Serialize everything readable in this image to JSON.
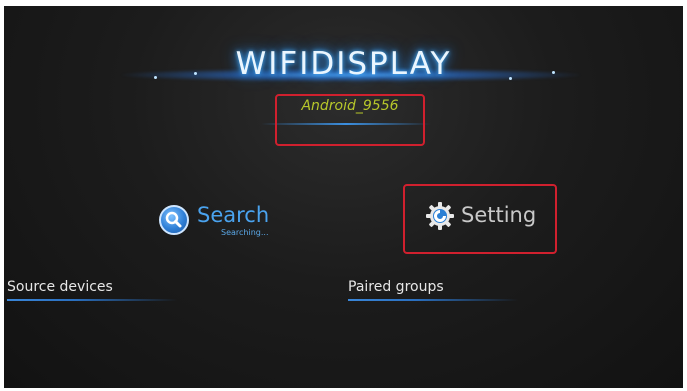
{
  "app": {
    "logo_text": "WIFIDISPLAY",
    "device_name": "Android_9556"
  },
  "buttons": {
    "search_label": "Search",
    "search_status": "Searching...",
    "search_icon": "search-icon",
    "setting_label": "Setting",
    "setting_icon": "gear-icon"
  },
  "sections": {
    "source_devices": "Source devices",
    "paired_groups": "Paired groups"
  },
  "colors": {
    "background": "#1c1c1c",
    "accent_blue": "#4aa3ef",
    "device_name": "#b7c72a",
    "highlight": "#d0202e"
  }
}
